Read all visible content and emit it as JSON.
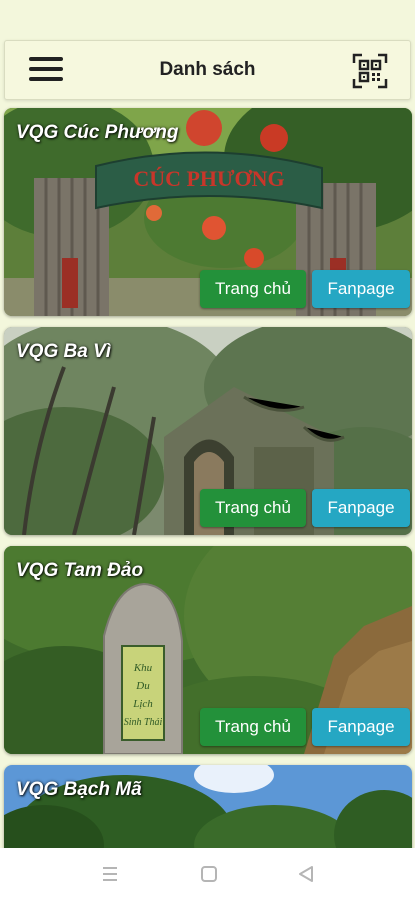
{
  "header": {
    "title": "Danh sách",
    "menu_icon": "hamburger-menu-icon",
    "qr_icon": "qr-scan-icon"
  },
  "parks": [
    {
      "name": "VQG Cúc Phương",
      "sign_text": "CÚC PHƯƠNG",
      "home_label": "Trang chủ",
      "fanpage_label": "Fanpage"
    },
    {
      "name": "VQG Ba Vì",
      "home_label": "Trang chủ",
      "fanpage_label": "Fanpage"
    },
    {
      "name": "VQG Tam Đảo",
      "stone_text": "Khu Du Lịch Sinh Thái",
      "home_label": "Trang chủ",
      "fanpage_label": "Fanpage"
    },
    {
      "name": "VQG Bạch Mã"
    }
  ],
  "navbar": {
    "icons": [
      "recent-apps-icon",
      "home-circle-icon",
      "back-triangle-icon"
    ]
  },
  "colors": {
    "background": "#f3f7dc",
    "home_button": "#23913a",
    "fanpage_button": "#25a7c3"
  }
}
